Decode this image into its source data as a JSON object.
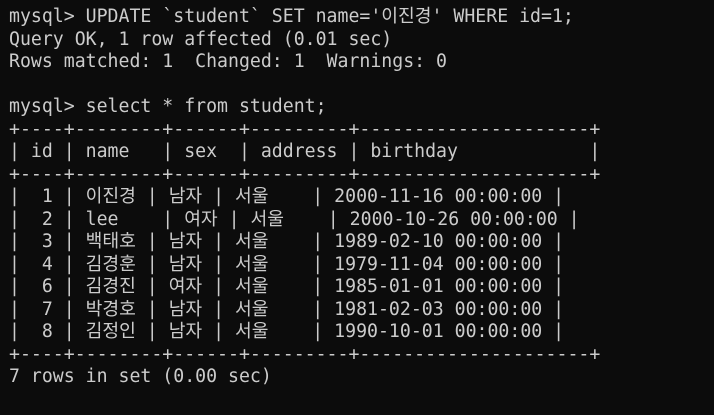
{
  "terminal": {
    "colors": {
      "background": "#0c0c0c",
      "foreground": "#cccccc"
    },
    "lines": [
      "mysql> UPDATE `student` SET name='이진경' WHERE id=1;",
      "Query OK, 1 row affected (0.01 sec)",
      "Rows matched: 1  Changed: 1  Warnings: 0",
      "",
      "mysql> select * from student;",
      "+----+--------+------+---------+---------------------+",
      "| id | name   | sex  | address | birthday            |",
      "+----+--------+------+---------+---------------------+",
      "|  1 | 이진경 | 남자 | 서울    | 2000-11-16 00:00:00 |",
      "|  2 | lee    | 여자 | 서울    | 2000-10-26 00:00:00 |",
      "|  3 | 백태호 | 남자 | 서울    | 1989-02-10 00:00:00 |",
      "|  4 | 김경훈 | 남자 | 서울    | 1979-11-04 00:00:00 |",
      "|  6 | 김경진 | 여자 | 서울    | 1985-01-01 00:00:00 |",
      "|  7 | 박경호 | 남자 | 서울    | 1981-02-03 00:00:00 |",
      "|  8 | 김정인 | 남자 | 서울    | 1990-10-01 00:00:00 |",
      "+----+--------+------+---------+---------------------+",
      "7 rows in set (0.00 sec)"
    ]
  }
}
